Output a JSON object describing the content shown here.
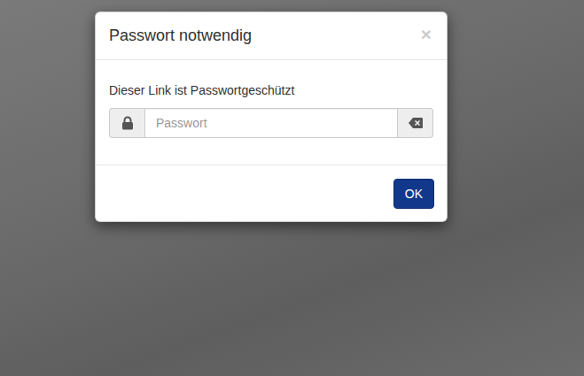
{
  "dialog": {
    "title": "Passwort notwendig",
    "close": "×",
    "message": "Dieser Link ist Passwortgeschützt",
    "field": {
      "placeholder": "Passwort",
      "value": ""
    },
    "buttons": [
      "OK"
    ]
  }
}
